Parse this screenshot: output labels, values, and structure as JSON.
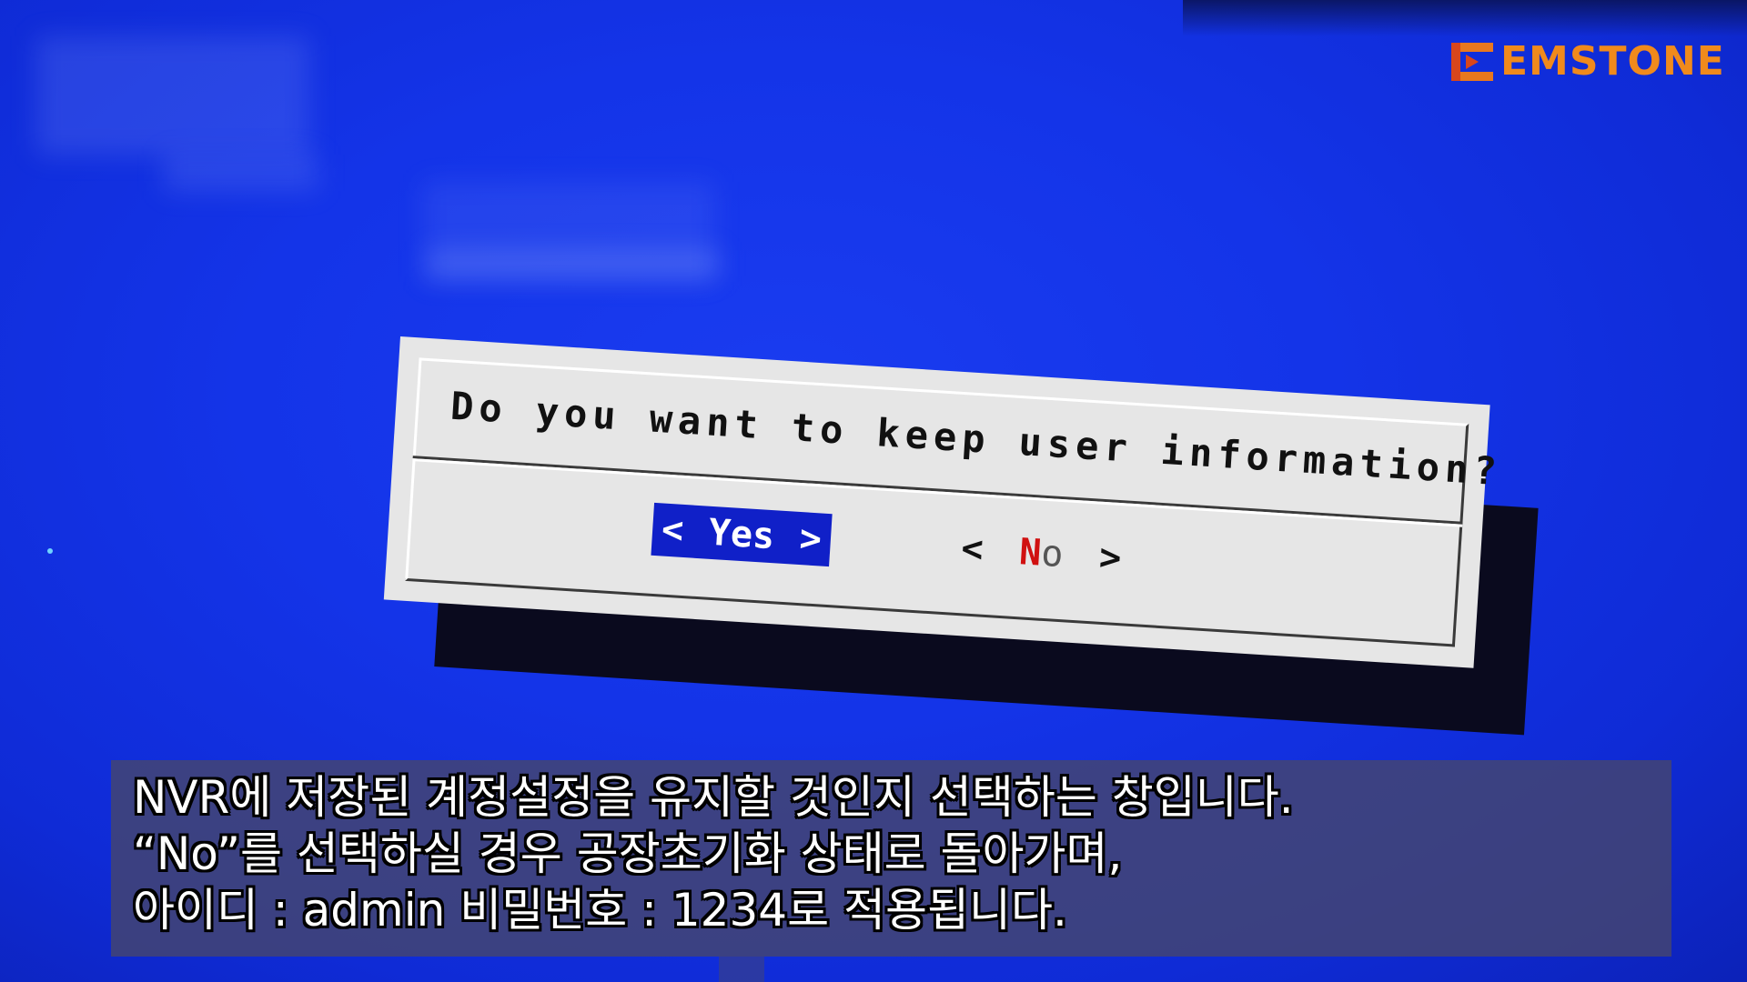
{
  "logo": {
    "text": "EMSTONE",
    "color": "#f08a1c"
  },
  "dialog": {
    "prompt": "Do you want to keep user information?",
    "buttons": {
      "yes": {
        "left_bracket": "<",
        "label": "Yes",
        "right_bracket": ">",
        "selected": true
      },
      "no": {
        "left_bracket": "<",
        "hotkey": "N",
        "label_rest": "o",
        "right_bracket": ">",
        "selected": false
      }
    },
    "colors": {
      "background": "#1434e8",
      "dialog_fill": "#e6e6e6",
      "selected_button": "#1020c8",
      "hotkey": "#d01010"
    }
  },
  "subtitle": {
    "lines": [
      "NVR에 저장된 계정설정을 유지할 것인지 선택하는 창입니다.",
      "“No”를 선택하실 경우 공장초기화 상태로 돌아가며,",
      "아이디 : admin 비밀번호 : 1234로 적용됩니다."
    ]
  }
}
